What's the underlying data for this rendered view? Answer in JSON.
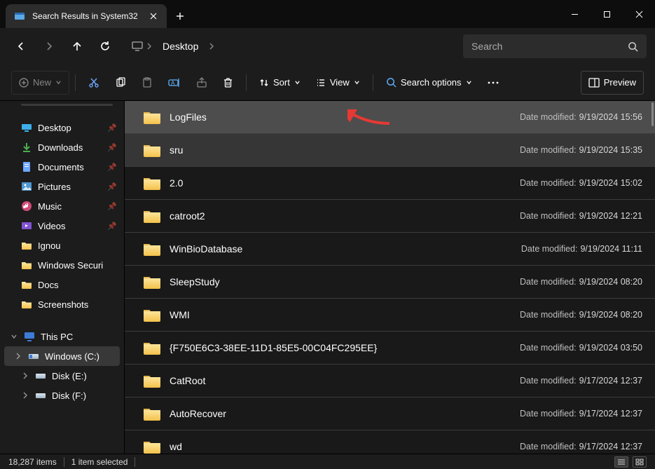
{
  "tab": {
    "title": "Search Results in System32"
  },
  "breadcrumb": {
    "items": [
      "Desktop"
    ]
  },
  "search": {
    "placeholder": "Search"
  },
  "toolbar": {
    "new": "New",
    "sort": "Sort",
    "view": "View",
    "search_options": "Search options",
    "preview": "Preview"
  },
  "sidebar": {
    "quick": [
      {
        "name": "Desktop",
        "icon": "desktop",
        "pinned": true
      },
      {
        "name": "Downloads",
        "icon": "downloads",
        "pinned": true
      },
      {
        "name": "Documents",
        "icon": "documents",
        "pinned": true
      },
      {
        "name": "Pictures",
        "icon": "pictures",
        "pinned": true
      },
      {
        "name": "Music",
        "icon": "music",
        "pinned": true
      },
      {
        "name": "Videos",
        "icon": "videos",
        "pinned": true
      },
      {
        "name": "Ignou",
        "icon": "folder",
        "pinned": false
      },
      {
        "name": "Windows Securi",
        "icon": "folder",
        "pinned": false
      },
      {
        "name": "Docs",
        "icon": "folder",
        "pinned": false
      },
      {
        "name": "Screenshots",
        "icon": "folder",
        "pinned": false
      }
    ],
    "thispc": {
      "label": "This PC",
      "drives": [
        {
          "name": "Windows (C:)",
          "selected": true,
          "icon": "drive-win"
        },
        {
          "name": "Disk (E:)",
          "selected": false,
          "icon": "drive"
        },
        {
          "name": "Disk (F:)",
          "selected": false,
          "icon": "drive"
        }
      ]
    }
  },
  "results": [
    {
      "name": "LogFiles",
      "modified": "9/19/2024 15:56",
      "state": "selected"
    },
    {
      "name": "sru",
      "modified": "9/19/2024 15:35",
      "state": "highlight"
    },
    {
      "name": "2.0",
      "modified": "9/19/2024 15:02",
      "state": ""
    },
    {
      "name": "catroot2",
      "modified": "9/19/2024 12:21",
      "state": ""
    },
    {
      "name": "WinBioDatabase",
      "modified": "9/19/2024 11:11",
      "state": ""
    },
    {
      "name": "SleepStudy",
      "modified": "9/19/2024 08:20",
      "state": ""
    },
    {
      "name": "WMI",
      "modified": "9/19/2024 08:20",
      "state": ""
    },
    {
      "name": "{F750E6C3-38EE-11D1-85E5-00C04FC295EE}",
      "modified": "9/19/2024 03:50",
      "state": ""
    },
    {
      "name": "CatRoot",
      "modified": "9/17/2024 12:37",
      "state": ""
    },
    {
      "name": "AutoRecover",
      "modified": "9/17/2024 12:37",
      "state": ""
    },
    {
      "name": "wd",
      "modified": "9/17/2024 12:37",
      "state": ""
    }
  ],
  "meta_label": "Date modified:",
  "status": {
    "count": "18,287 items",
    "selection": "1 item selected"
  }
}
